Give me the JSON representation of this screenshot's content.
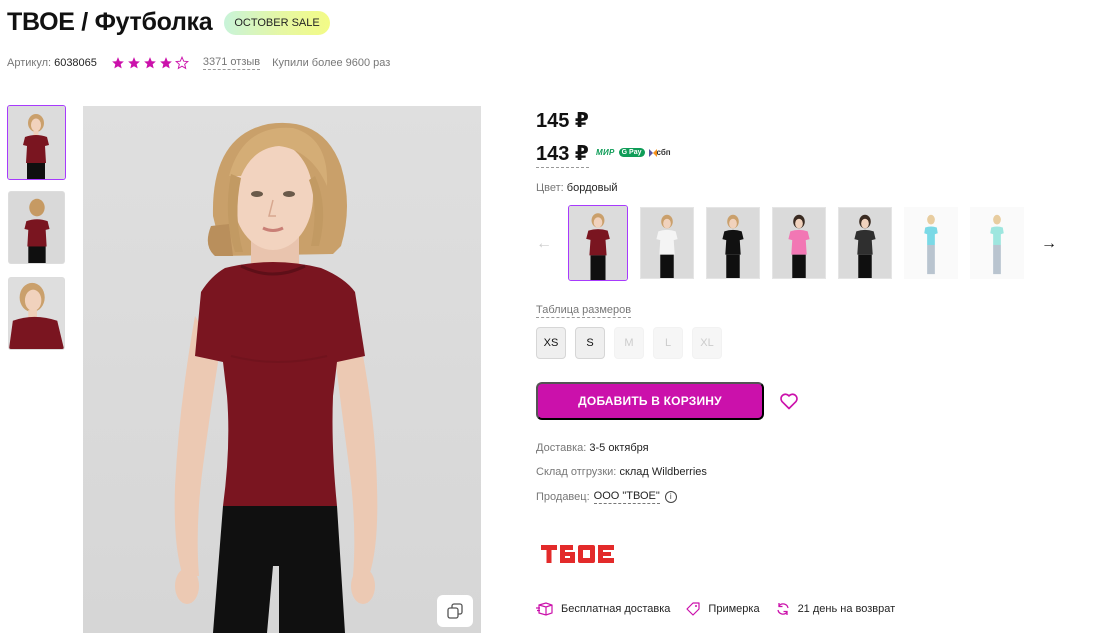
{
  "product": {
    "brand": "ТВОЕ",
    "separator": " / ",
    "name": "Футболка",
    "badge": "OCTOBER SALE"
  },
  "meta": {
    "article_label": "Артикул:",
    "article_value": "6038065",
    "rating_stars_filled": 4,
    "rating_stars_total": 5,
    "reviews": "3371 отзыв",
    "bought": "Купили более 9600 раз"
  },
  "gallery": {
    "thumbnails": [
      "front",
      "back",
      "closeup"
    ],
    "active_index": 0,
    "zoom_icon": "zoom-icon"
  },
  "pricing": {
    "price_old": "145 ₽",
    "price_card": "143 ₽",
    "payment_logos": [
      "МИР",
      "Pay",
      "сбп"
    ]
  },
  "color": {
    "label": "Цвет:",
    "value": "бордовый",
    "swatches": [
      {
        "name": "бордовый",
        "hex": "#7a1520"
      },
      {
        "name": "белый",
        "hex": "#f4f4f4"
      },
      {
        "name": "черный",
        "hex": "#111111"
      },
      {
        "name": "розовый",
        "hex": "#f277b4"
      },
      {
        "name": "темно-серый",
        "hex": "#2f2f2f"
      },
      {
        "name": "голубой",
        "hex": "#7ad9e6"
      },
      {
        "name": "мятный",
        "hex": "#9ee6df"
      }
    ],
    "active_index": 0
  },
  "sizes": {
    "table_label": "Таблица размеров",
    "items": [
      {
        "label": "XS",
        "available": true
      },
      {
        "label": "S",
        "available": true
      },
      {
        "label": "M",
        "available": false
      },
      {
        "label": "L",
        "available": false
      },
      {
        "label": "XL",
        "available": false
      }
    ]
  },
  "actions": {
    "add_to_cart": "ДОБАВИТЬ В КОРЗИНУ"
  },
  "info": {
    "delivery_label": "Доставка:",
    "delivery_value": "3-5 октября",
    "store_label": "Склад отгрузки:",
    "store_value": "склад Wildberries",
    "seller_label": "Продавец:",
    "seller_value": "ООО \"ТВОЕ\"",
    "info_icon": "i"
  },
  "brand_logo_text": "ТВОЕ",
  "features": [
    {
      "label": "Бесплатная доставка",
      "icon": "box-icon"
    },
    {
      "label": "Примерка",
      "icon": "tag-icon"
    },
    {
      "label": "21 день на возврат",
      "icon": "return-icon"
    }
  ],
  "colors": {
    "accent": "#cb11ab",
    "active_border": "#a73afd",
    "star": "#cb11ab"
  }
}
